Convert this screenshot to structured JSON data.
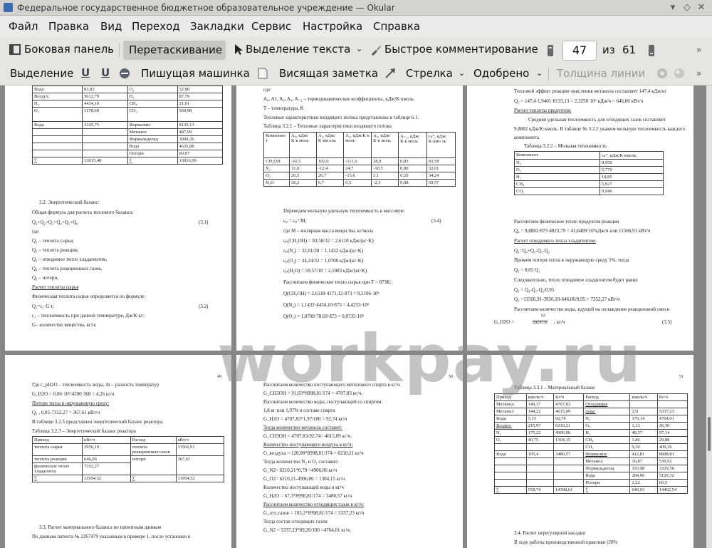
{
  "window": {
    "title": "Федеральное государственное бюджетное образовательное учреждение — Okular"
  },
  "menu": [
    "Файл",
    "Правка",
    "Вид",
    "Переход",
    "Закладки",
    "Сервис",
    "Настройка",
    "Справка"
  ],
  "toolbar": {
    "sidebar": "Боковая панель",
    "drag": "Перетаскивание",
    "text_select": "Выделение текста",
    "quick_comment": "Быстрое комментирование",
    "current_page": "47",
    "of": "из",
    "total_pages": "61"
  },
  "annot_toolbar": {
    "highlight": "Выделение",
    "typewriter": "Пишущая машинка",
    "popup_note": "Висящая заметка",
    "arrow": "Стрелка",
    "approved": "Одобрено",
    "line_width": "Толщина линии"
  },
  "watermark": "workpay.ru",
  "pages": {
    "p1": {
      "table": [
        [
          "Вода",
          "83,82",
          "O₂",
          "32,80"
        ],
        [
          "Воздух:",
          "5612,79",
          "H₂",
          "87,79"
        ],
        [
          "N₂",
          "4434,10",
          "CH₄",
          "21,01"
        ],
        [
          "O₂",
          "1178,69",
          "CO₂",
          "569,98"
        ],
        [
          "Вода",
          "3145,75",
          "Формалин:",
          "8135,13"
        ],
        [
          "",
          "",
          "Метанол",
          "487,99"
        ],
        [
          "",
          "",
          "Формальдегид",
          "3009,26"
        ],
        [
          "",
          "",
          "Вода",
          "4635,88"
        ],
        [
          "",
          "",
          "Потери",
          "60,07"
        ],
        [
          "∑",
          "13015,48",
          "∑",
          "13016,99"
        ]
      ],
      "lines": [
        "3.2.    Энергетический баланс:",
        "Общая формула для расчета теплового баланса:",
        "Q₁+Q₂+Q₃=Q₄+Q₅+Q₆",
        "(3.1)",
        "где",
        "Q₁ – теплота сырья,",
        "Q₂ – теплота реакции,",
        "Q₃ – отводимое тепло хладагентом,",
        "Q₄ – теплота реакционных газов,",
        "Q₅ – потери,",
        "Расчет теплоты сырья",
        "Физическая теплота сырья определяется по формуле:",
        "Q₁=c₁·G·t;",
        "(3.2)",
        "c₁ – теплоемкость при данной температуре, Дж/К·кг;",
        "G– количество вещества, кг/ч;"
      ]
    },
    "p2": {
      "lines": [
        "где:",
        "A₀, A1, A₂, A₃, A₋₂ – термодинамические коэффициенты, кДж/К·кмоль",
        "T – температура, К",
        "Тепловые характеристики входящего потока представлены в таблице 6.1.",
        "Таблица 3.2.1 – Тепловые характеристики входящего потока",
        "Переведем мольную удельную теплоемкость в массовую",
        "cₚ = cₚ°/M,",
        "(3.4)",
        "где M – молярная масса вещества, кг/моль",
        "cₚ(CH₃OH) = 83,58/32 = 2,6118 кДж/(кг·K)",
        "cₚ(N₂) = 32,01/28 = 1,1432 кДж/(кг·K)",
        "cₚ(O₂) = 34,24/32 = 1,0700 кДж/(кг·K)",
        "cₚ(H₂O) = 59,57/18 = 2,1983 кДж/(кг·K)",
        "Рассчитаем физическое тепло сырья при T = 873К:",
        "Q(CH₃OH) = 2,6118·4171,12·873 = 9,5106·10⁶",
        "Q(N₂) = 1,1432·4434,10·873 = 4,4253·10⁶",
        "Q(O₂) = 1,0700·78,69·873 = 0,0735·10⁶"
      ],
      "table": [
        [
          "Компонен т",
          "A₀, кДж/К·к моль",
          "A₁, кДж/К·км оль",
          "A₂, кДж/К·к моль",
          "A₃, кДж/К·к моль",
          "A₋₂, кДж/К·к моль",
          "cₚ°, кДж/К·кмо ль"
        ],
        [
          "CH₃OH",
          "-10,5",
          "182,0",
          "-111,6",
          "28,8",
          "0,83",
          "83,58"
        ],
        [
          "N₂",
          "31,0",
          "-12,4",
          "24,7",
          "-10,5",
          "0,00",
          "32,01"
        ],
        [
          "O₂",
          "20,5",
          "26,7",
          "-15,6",
          "3,1",
          "0,20",
          "34,24"
        ],
        [
          "H₂O",
          "30,2",
          "6,7",
          "6,5",
          "-2,3",
          "0,08",
          "59,57"
        ]
      ]
    },
    "p3": {
      "lines": [
        "Тепловой эффект реакции окисления метанола составляет 147,4 кДж/кг",
        "Q₂ = 147,4·1,9401·8133,13 = 2,3258·10⁶ кДж/ч = 646,06 кВт/ч",
        "Расчет теплоты продуктов:",
        "Средняя удельная теплоемкость для отходящих газов составляет",
        "9,8882 кДж/К·кмоль. В таблице № 3.2.2 укажем мольную теплоемкость каждого",
        "компонента",
        "Таблица 3.2.2 – Мольная теплоемкость",
        "Рассчитаем физическое тепло продуктов реакции",
        "Q₄ = 9,8882·873·4823,79 = 41,6409·10⁶кДж/ч или 11566,91 кВт/ч",
        "Расчет отводимого тепла хладагентом:",
        "Q₃=Q₄+Q₅-Q₁-Q₂",
        "Примем потери тепла в окружающую среду 5%, тогда",
        "Q₅ = 0,05 Q₁",
        "Следовательно, тепло отводимое хладагентом будет равно",
        "Q₃ = Q₄-Q₁-Q₂/0,95",
        "Q₃ =11566,91-3956,19-646,06/0,95 = 7352,27 кВт/ч",
        "Рассчитаем количество воды, идущей на охлаждение реакционной смеси",
        "G_H2O =",
        "Q3",
        "cpH2O·Δt",
        "; кг/ч",
        "(3.5)"
      ],
      "table": [
        [
          "Компонент",
          "cₚ°, кДж/К·кмоль"
        ],
        [
          "N₂",
          "8,959"
        ],
        [
          "O₂",
          "5,779"
        ],
        [
          "H₂",
          "18,85"
        ],
        [
          "CH₄",
          "5,927"
        ],
        [
          "CO₂",
          "9,946"
        ]
      ]
    },
    "p4": {
      "num": "49",
      "lines": [
        "Где c_pH2O – теплоемкость воды, Δt – разность температур",
        "G_H2O = 0,06·10⁶/4200·368 = 4,26 кг/ч",
        "Потери тепла в окружающую среду:",
        "Q₅ , 0,05·7352,27 = 367,61 кВт/ч",
        "В таблице 3.2.3 представлен энергетический баланс реактора.",
        "Таблица 3.2.3 – Энергетический баланс реактора",
        "3.3.    Расчет материального баланса по патентным данным",
        "По данным патента № 2267479 указанным в примере 1, после установки в"
      ],
      "table": [
        [
          "Приход",
          "кВт/ч",
          "Расход",
          "кВт/ч"
        ],
        [
          "теплота сырья",
          "3956,19",
          "теплота реакционных газов",
          "11566,91"
        ],
        [
          "теплота реакции",
          "646,06",
          "потери",
          "367,61"
        ],
        [
          "физическое тепло хладагента",
          "7352,27",
          "",
          ""
        ],
        [
          "∑",
          "11954,52",
          "∑",
          "11954,52"
        ]
      ]
    },
    "p5": {
      "num": "50",
      "lines": [
        "Рассчитаем количество поступающего метилового спирта в кг/ч.",
        "G_CH3OH = 91,03*8998,81/174 = 4707,83 кг/ч.",
        "Рассчитаем количество воды, поступающей со спиртом:",
        "1,8 кг или 1,97% в составе спирта",
        "G_H2O = 4707,83*1,97/100 = 92,74 кг/ч",
        "Тогда количество метанола составит:",
        "G_CH3OH = 4707,83-92,74= 4615,09 кг/ч.",
        "Количество поступающего воздуха в кг/ч:",
        "G_воздуха = 120,08*8998,81/174 = 6210,21 кг/ч",
        "Тогда количество N₂ и O₂ составит:",
        "G_N2= 6210,21*0,79 =4906,06 кг/ч",
        "G_O2= 6210,21-4906,06 = 1304,15 кг/ч",
        "Количество поступающей воды в кг/ч",
        "G_H2O = 67,3*8998,81/174 = 3480,57 кг/ч",
        "Рассчитаем количество отходящих газов в кг/ч:",
        "G_отх.газов = 103,2*8998,81/174 = 5337,23 кг/ч",
        "Тогда состав отходящих газов:",
        "G_N2 = 5337,23*89,26/100 =4764,01 кг/ч;"
      ]
    },
    "p6": {
      "num": "51",
      "title": "Таблица 3.3.1 – Материальный баланс",
      "table": [
        [
          "Приход",
          "кмоль/ч",
          "Кг/ч",
          "Расход",
          "кмоль/ч",
          "Кг/ч"
        ],
        [
          "Метанол:",
          "149,37",
          "4707,83",
          "Отходящие",
          "",
          ""
        ],
        [
          "Метанол",
          "144,22",
          "4615,09",
          "газы:",
          "231",
          "5337,23"
        ],
        [
          "Вода",
          "5,15",
          "92,74",
          "N₂",
          "170,14",
          "4764,01"
        ],
        [
          "Воздух:",
          "215,97",
          "6210,21",
          "O₂",
          "1,13",
          "36,30"
        ],
        [
          "N₂",
          "175,22",
          "4906,06",
          "H₂",
          "48,57",
          "97,14"
        ],
        [
          "O₂",
          "40,75",
          "1304,15",
          "CH₄",
          "1,86",
          "29,88"
        ],
        [
          "",
          "",
          "",
          "CO₂",
          "9,30",
          "409,36"
        ],
        [
          "Вода",
          "195,4",
          "3480,57",
          "Формалин:",
          "412,81",
          "8998,81"
        ],
        [
          "",
          "",
          "",
          "Метанол",
          "16,87",
          "539,92"
        ],
        [
          "",
          "",
          "",
          "Формальдегид",
          "110,98",
          "3329,56"
        ],
        [
          "",
          "",
          "",
          "Вода",
          "284,96",
          "5129,32"
        ],
        [
          "",
          "",
          "",
          "Потери",
          "2,22",
          "66,5"
        ],
        [
          "∑",
          "558,74",
          "14398,61",
          "∑",
          "646,03",
          "14402,54"
        ]
      ],
      "footer": "3.4.    Расчет нерегулярной насадки",
      "footer2": "В ходе работы производственной практики (20%"
    }
  }
}
